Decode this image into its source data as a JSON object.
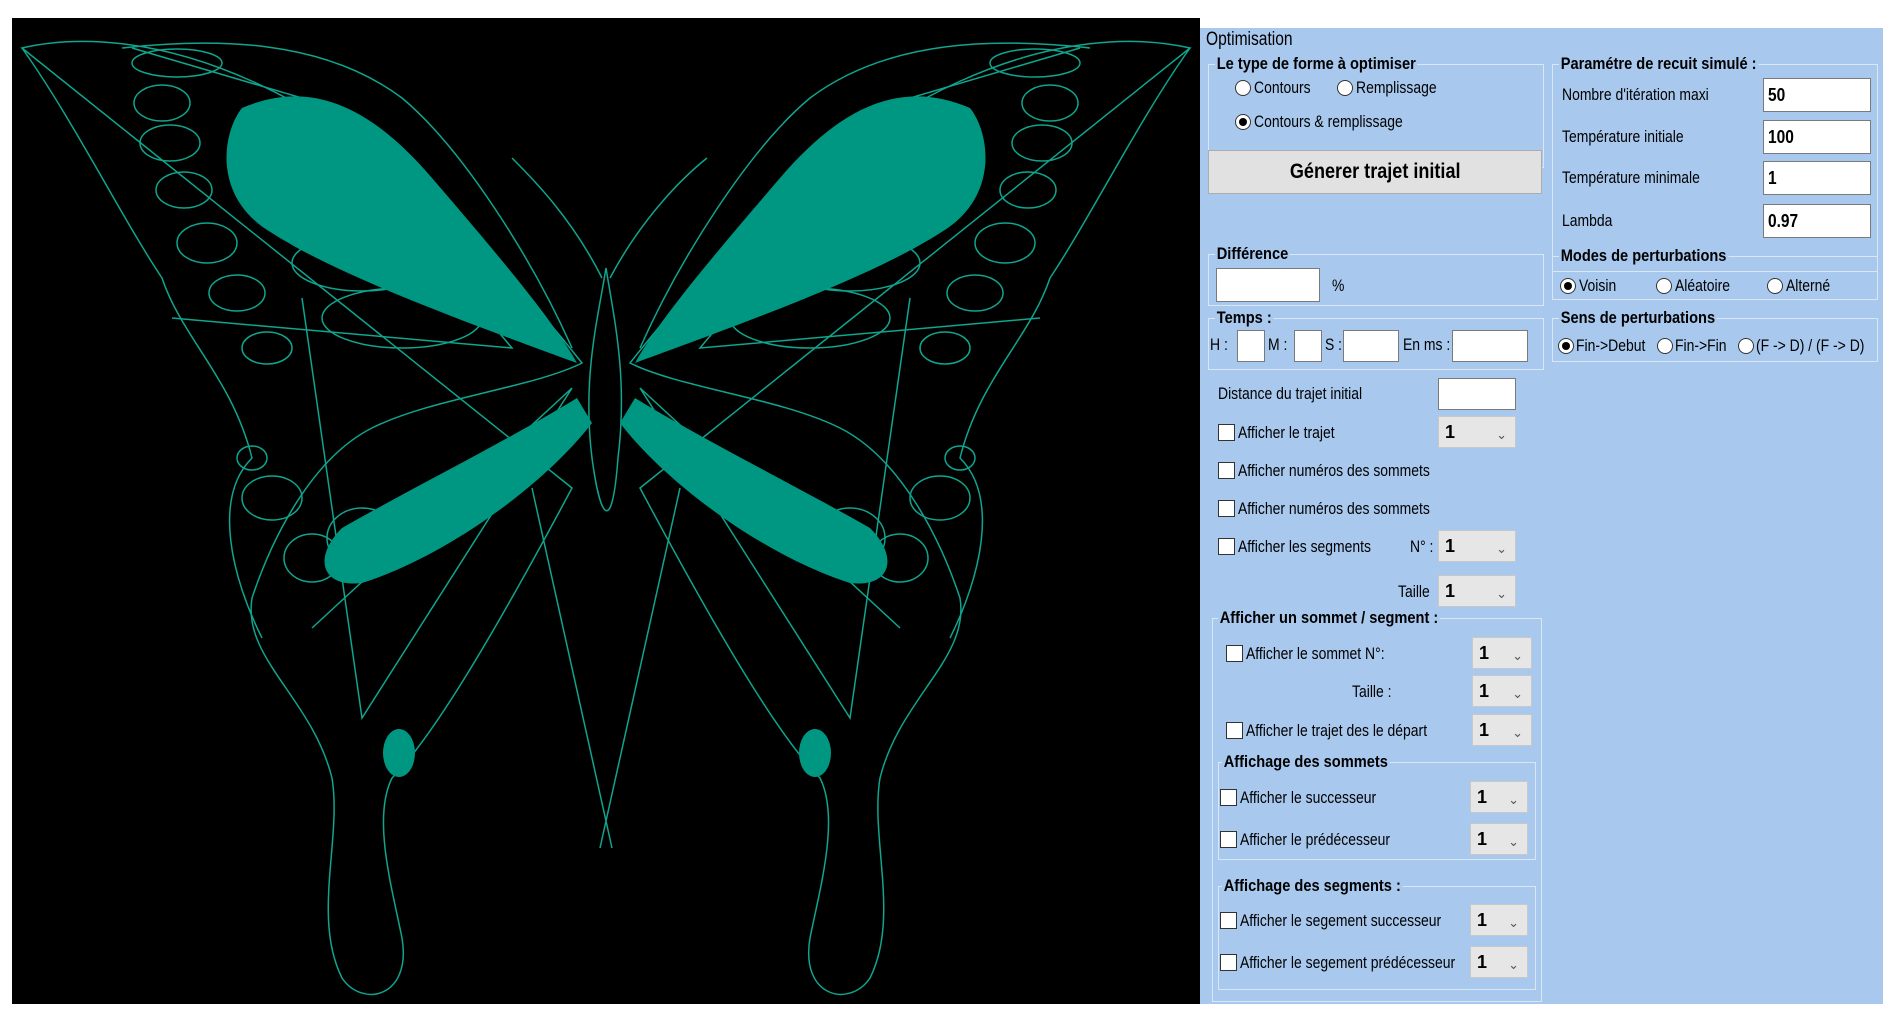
{
  "colors": {
    "drawing_bg": "#000000",
    "wing_stroke": "#0fa58e",
    "wing_fill": "#009782",
    "panel_bg": "#a8c8ee"
  },
  "panel": {
    "title": "Optimisation",
    "shape_type": {
      "title": "Le type de forme à optimiser",
      "options": [
        "Contours",
        "Remplissage",
        "Contours & remplissage"
      ],
      "selected": "Contours & remplissage"
    },
    "generate_button": "Génerer trajet initial",
    "recuit": {
      "title": "Paramétre de recuit simulé :",
      "fields": [
        {
          "label": "Nombre d'itération maxi",
          "value": "50"
        },
        {
          "label": "Température initiale",
          "value": "100"
        },
        {
          "label": "Température minimale",
          "value": "1"
        },
        {
          "label": "Lambda",
          "value": "0.97"
        }
      ]
    },
    "difference": {
      "title": "Différence",
      "value": "",
      "unit": "%"
    },
    "temps": {
      "title": "Temps :",
      "h_label": "H :",
      "m_label": "M :",
      "s_label": "S :",
      "ms_label": "En ms :"
    },
    "modes": {
      "title": "Modes de perturbations",
      "options": [
        "Voisin",
        "Aléatoire",
        "Alterné"
      ],
      "selected": "Voisin"
    },
    "sens": {
      "title": "Sens de perturbations",
      "options": [
        "Fin->Debut",
        "Fin->Fin",
        "(F -> D) / (F -> D)"
      ],
      "selected": "Fin->Debut"
    },
    "distance_label": "Distance du trajet initial",
    "show_path": {
      "label": "Afficher le trajet",
      "value": "1"
    },
    "show_vertex_numbers_1": "Afficher numéros des sommets",
    "show_vertex_numbers_2": "Afficher numéros des sommets",
    "show_segments": {
      "label": "Afficher les segments",
      "n_label": "N° :",
      "n_value": "1",
      "size_label": "Taille",
      "size_value": "1"
    },
    "vertex_segment": {
      "title": "Afficher un sommet / segment :",
      "show_vertex": {
        "label": "Afficher le sommet N°:",
        "value": "1"
      },
      "size": {
        "label": "Taille :",
        "value": "1"
      },
      "show_path_from": {
        "label": "Afficher le trajet des le départ",
        "value": "1"
      },
      "vertex_display": {
        "title": "Affichage des sommets",
        "successor": {
          "label": "Afficher le successeur",
          "value": "1"
        },
        "predecessor": {
          "label": "Afficher le prédécesseur",
          "value": "1"
        }
      },
      "segment_display": {
        "title": "Affichage des segments :",
        "successor": {
          "label": "Afficher le segement successeur",
          "value": "1"
        },
        "predecessor": {
          "label": "Afficher le segement prédécesseur",
          "value": "1"
        }
      }
    }
  }
}
